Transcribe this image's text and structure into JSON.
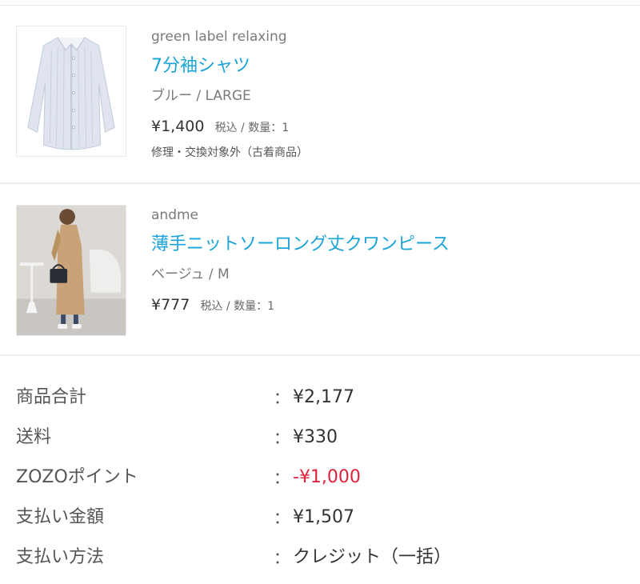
{
  "items": [
    {
      "brand": "green label relaxing",
      "name": "7分袖シャツ",
      "variant": "ブルー / LARGE",
      "price": "¥1,400",
      "tax_qty": "税込 / 数量：1",
      "note": "修理・交換対象外（古着商品）"
    },
    {
      "brand": "andme",
      "name": "薄手ニットソーロング丈クワンピース",
      "variant": "ベージュ / M",
      "price": "¥777",
      "tax_qty": "税込 / 数量：1"
    }
  ],
  "summary": {
    "colon": "：",
    "rows": [
      {
        "label": "商品合計",
        "value": "¥2,177"
      },
      {
        "label": "送料",
        "value": "¥330"
      },
      {
        "label": "ZOZOポイント",
        "value": "-¥1,000"
      },
      {
        "label": "支払い金額",
        "value": "¥1,507"
      },
      {
        "label": "支払い方法",
        "value": "クレジット（一括）"
      }
    ]
  },
  "colors": {
    "product_link": "#1aa3d8",
    "discount": "#e0223c"
  }
}
